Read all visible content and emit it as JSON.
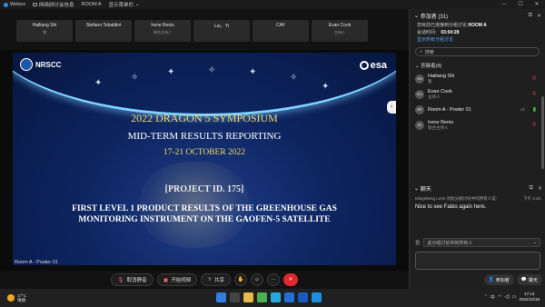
{
  "titlebar": {
    "app_name": "Webex",
    "meeting_info": "网络研讨会信息",
    "room": "ROOM A",
    "show_menu": "显示菜单栏",
    "minimize": "─",
    "maximize": "☐",
    "close": "✕"
  },
  "tiles": [
    {
      "name": "Hailiang Shi",
      "role": "我"
    },
    {
      "name": "Stefano Tebaldini",
      "role": ""
    },
    {
      "name": "Irene Renis",
      "role": "联合主持人"
    },
    {
      "name": "Liu，Yi",
      "role": ""
    },
    {
      "name": "CAF",
      "role": ""
    },
    {
      "name": "Evan Cook",
      "role": "主持人"
    }
  ],
  "slide": {
    "logo_left": "NRSCC",
    "logo_right": "esa",
    "title": "2022 DRAGON 5 SYMPOSIUM",
    "subtitle": "MID-TERM RESULTS REPORTING",
    "dates": "17-21 OCTOBER 2022",
    "project": "[PROJECT ID. 175]",
    "paper_line1": "FIRST LEVEL 1 PRODUCT RESULTS OF THE GREENHOUSE GAS",
    "paper_line2": "MONITORING INSTRUMENT ON THE GAOFEN-5 SATELLITE"
  },
  "stage_label": "Room A - Poster 01",
  "side_tab_icon": "‹",
  "controls": {
    "unmute": "取消静音",
    "start_video": "开始视频",
    "share": "共享",
    "more": "···"
  },
  "panel": {
    "participants_title": "参加者 (31)",
    "connected_to": "您目前已连接到分组讨论",
    "room_name": "ROOM A",
    "duration_label": "会话时间：",
    "duration": "03:04:28",
    "show_all": "显示所有分组讨论",
    "search_placeholder": "搜索",
    "group_title": "答疑者(8)",
    "participants": [
      {
        "initials": "HS",
        "name": "Hailiang Shi",
        "role": "我",
        "mic": "muted"
      },
      {
        "initials": "EC",
        "name": "Evan Cook",
        "role": "主持人",
        "mic": "muted"
      },
      {
        "initials": "RP",
        "name": "Room A - Poster 01",
        "role": "",
        "mic": "on",
        "video": true
      },
      {
        "initials": "IR",
        "name": "Irene Renis",
        "role": "联合主持人",
        "mic": "muted"
      }
    ],
    "chat_title": "聊天",
    "chat_sender": "Mingsheng LIAO 对此分组讨论中的所有人说：",
    "chat_time": "下午 4:43",
    "chat_message": "Nice to see Fabio again here.",
    "to_label": "至:",
    "to_value": "此分组讨论中的所有人",
    "btn_participants": "参加者",
    "btn_chat": "聊天"
  },
  "taskbar": {
    "temp": "17°C",
    "weather": "晴朗",
    "lang": "中",
    "time": "17:13",
    "date": "2022/10/18"
  },
  "colors": {
    "accent": "#2b8ee0",
    "end_call": "#e0262e",
    "slide_gold": "#f2d86a"
  }
}
